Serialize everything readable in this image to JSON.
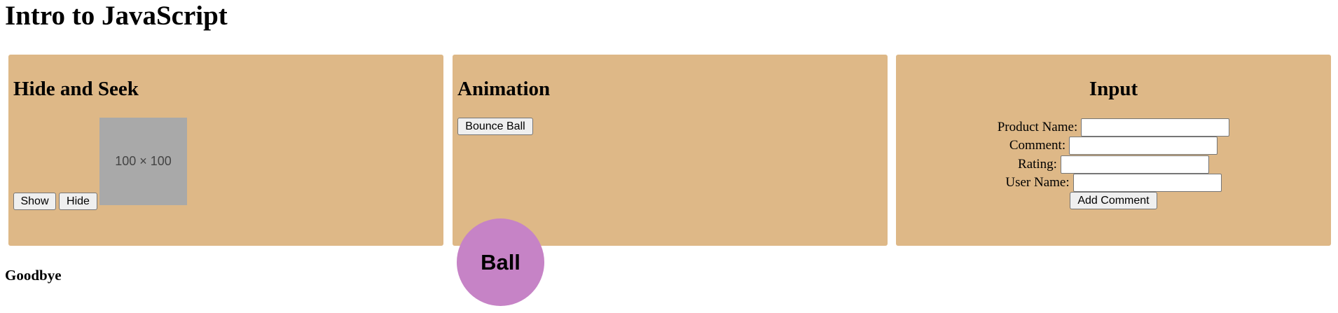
{
  "page": {
    "title": "Intro to JavaScript",
    "footer_text": "Goodbye"
  },
  "colors": {
    "panel_background": "#DEB887",
    "ball_color": "#C683C6",
    "placeholder_background": "#A9A9A9"
  },
  "hide_and_seek": {
    "heading": "Hide and Seek",
    "show_label": "Show",
    "hide_label": "Hide",
    "image_placeholder_text": "100 × 100"
  },
  "animation": {
    "heading": "Animation",
    "bounce_label": "Bounce Ball",
    "ball_label": "Ball"
  },
  "input": {
    "heading": "Input",
    "fields": [
      {
        "label": "Product Name:",
        "value": ""
      },
      {
        "label": "Comment:",
        "value": ""
      },
      {
        "label": "Rating:",
        "value": ""
      },
      {
        "label": "User Name:",
        "value": ""
      }
    ],
    "submit_label": "Add Comment"
  }
}
